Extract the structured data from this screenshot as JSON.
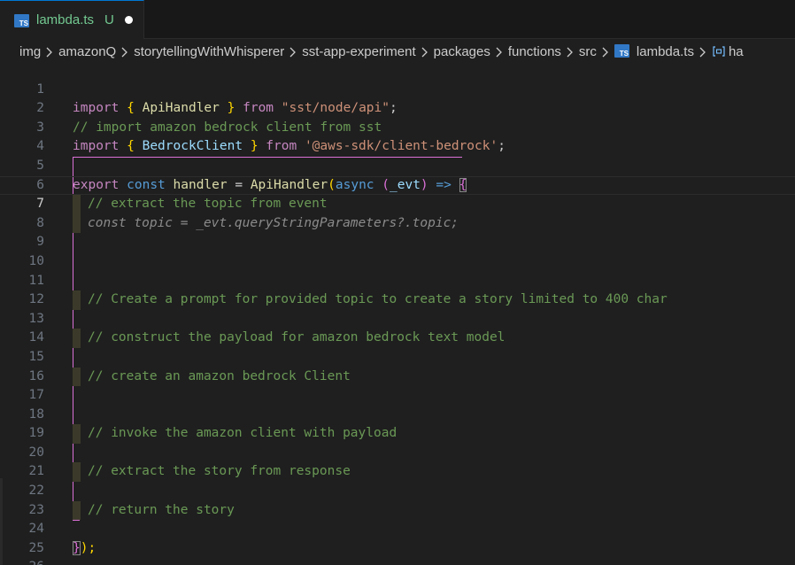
{
  "tab": {
    "icon_text": "TS",
    "filename": "lambda.ts",
    "status": "U"
  },
  "breadcrumb": {
    "items": [
      "img",
      "amazonQ",
      "storytellingWithWhisperer",
      "sst-app-experiment",
      "packages",
      "functions",
      "src"
    ],
    "file": "lambda.ts",
    "symbol": "ha"
  },
  "colors": {
    "background": "#1f1f1f",
    "tab_accent": "#0078d4",
    "untracked": "#73c991",
    "comment": "#6a9955",
    "keyword": "#569cd6",
    "string": "#ce9178",
    "function": "#dcdcaa",
    "bracket_guide": "#da70d6"
  },
  "code": {
    "current_line": 7,
    "lines": [
      {
        "n": "1"
      },
      {
        "n": "2",
        "text": "// import amazon bedrock client from sst"
      },
      {
        "n": "3"
      },
      {
        "n": "4"
      },
      {
        "n": "5"
      },
      {
        "n": "6",
        "text": "// extract the topic from event"
      },
      {
        "n": "7",
        "text": "const topic = _evt.queryStringParameters?.topic;"
      },
      {
        "n": "8"
      },
      {
        "n": "9"
      },
      {
        "n": "10"
      },
      {
        "n": "11",
        "text": "// Create a prompt for provided topic to create a story limited to 400 char"
      },
      {
        "n": "12"
      },
      {
        "n": "13",
        "text": "// construct the payload for amazon bedrock text model"
      },
      {
        "n": "14"
      },
      {
        "n": "15",
        "text": "// create an amazon bedrock Client"
      },
      {
        "n": "16"
      },
      {
        "n": "17"
      },
      {
        "n": "18",
        "text": "// invoke the amazon client with payload"
      },
      {
        "n": "19"
      },
      {
        "n": "20",
        "text": "// extract the story from response"
      },
      {
        "n": "21"
      },
      {
        "n": "22",
        "text": "// return the story"
      },
      {
        "n": "23"
      },
      {
        "n": "24"
      },
      {
        "n": "25"
      },
      {
        "n": "26"
      }
    ],
    "tokens": {
      "import": "import",
      "from": "from",
      "export": "export",
      "const": "const",
      "async": "async",
      "open_brace": "{",
      "close_brace": "}",
      "ApiHandler": "ApiHandler",
      "BedrockClient": "BedrockClient",
      "handler": "handler",
      "evt": "_evt",
      "str_api": "\"sst/node/api\"",
      "str_bedrock": "'@aws-sdk/client-bedrock'",
      "semicolon": ";",
      "eq": "=",
      "lparen": "(",
      "rparen": ")",
      "arrow": "=>",
      "close_call": ");"
    }
  }
}
